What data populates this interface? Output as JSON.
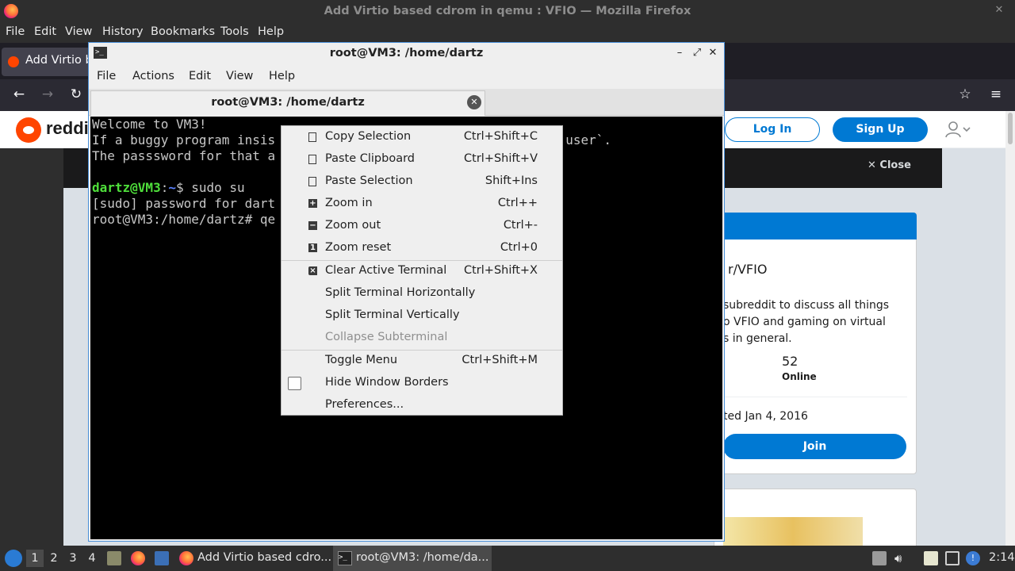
{
  "firefox": {
    "window_title": "Add Virtio based cdrom in qemu : VFIO — Mozilla Firefox",
    "menu": [
      "File",
      "Edit",
      "View",
      "History",
      "Bookmarks",
      "Tools",
      "Help"
    ],
    "tab_label": "Add Virtio b",
    "icons": [
      "firefox-logo-icon",
      "back-icon",
      "forward-icon",
      "reload-icon",
      "bookmark-star-icon",
      "hamburger-menu-icon"
    ]
  },
  "reddit": {
    "logo_text": "reddi",
    "login_label": "Log In",
    "signup_label": "Sign Up",
    "close_label": "Close",
    "subreddit": "r/VFIO",
    "description": "subreddit to discuss all things\no VFIO and gaming on virtual\ns in general.",
    "online_count": "52",
    "online_label": "Online",
    "created": "ted Jan 4, 2016",
    "join_label": "Join"
  },
  "terminal": {
    "window_title": "root@VM3: /home/dartz",
    "menu": [
      "File",
      "Actions",
      "Edit",
      "View",
      "Help"
    ],
    "tab_label": "root@VM3: /home/dartz",
    "lines": {
      "l1": "Welcome to VM3!",
      "l2a": "If a buggy program insis",
      "l2b": "user`.",
      "l3": "The passsword for that a",
      "l5_user": "dartz@VM3",
      "l5_colon": ":",
      "l5_path": "~",
      "l5_cmd": "$ sudo su",
      "l6": "[sudo] password for dart",
      "l7": "root@VM3:/home/dartz# qe"
    }
  },
  "context_menu": {
    "items": [
      {
        "label": "Copy Selection",
        "shortcut": "Ctrl+Shift+C",
        "icon": "copy-icon"
      },
      {
        "label": "Paste Clipboard",
        "shortcut": "Ctrl+Shift+V",
        "icon": "paste-icon"
      },
      {
        "label": "Paste Selection",
        "shortcut": "Shift+Ins",
        "icon": "paste-icon"
      },
      {
        "label": "Zoom in",
        "shortcut": "Ctrl++",
        "icon": "zoom-in-icon"
      },
      {
        "label": "Zoom out",
        "shortcut": "Ctrl+-",
        "icon": "zoom-out-icon"
      },
      {
        "label": "Zoom reset",
        "shortcut": "Ctrl+0",
        "icon": "zoom-reset-icon"
      },
      {
        "label": "Clear Active Terminal",
        "shortcut": "Ctrl+Shift+X",
        "icon": "clear-icon"
      },
      {
        "label": "Split Terminal Horizontally",
        "shortcut": ""
      },
      {
        "label": "Split Terminal Vertically",
        "shortcut": ""
      },
      {
        "label": "Collapse Subterminal",
        "shortcut": "",
        "disabled": true
      },
      {
        "label": "Toggle Menu",
        "shortcut": "Ctrl+Shift+M"
      },
      {
        "label": "Hide Window Borders",
        "shortcut": "",
        "checkbox": false
      },
      {
        "label": "Preferences...",
        "shortcut": ""
      }
    ]
  },
  "taskbar": {
    "workspaces": [
      "1",
      "2",
      "3",
      "4"
    ],
    "tasks": [
      "Add Virtio based cdro...",
      "root@VM3: /home/da..."
    ],
    "clock": "2:14"
  }
}
